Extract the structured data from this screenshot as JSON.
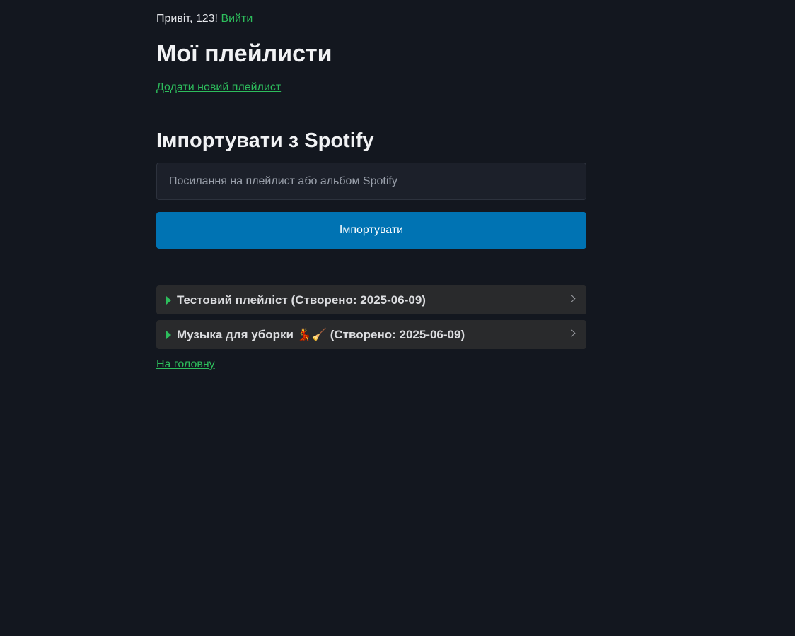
{
  "header": {
    "greeting": "Привіт, 123!",
    "logout_label": "Вийти"
  },
  "page_title": "Мої плейлисти",
  "add_playlist_label": "Додати новий плейлист",
  "spotify_import": {
    "title": "Імпортувати з Spotify",
    "input_placeholder": "Посилання на плейлист або альбом Spotify",
    "input_value": "",
    "button_label": "Імпортувати"
  },
  "playlists": [
    {
      "title": "Тестовий плейліст (Створено: 2025-06-09)"
    },
    {
      "title": "Музыка для уборки 💃🧹 (Створено: 2025-06-09)"
    }
  ],
  "home_link_label": "На головну",
  "colors": {
    "background": "#13171f",
    "accent_link": "#2dbd5c",
    "primary_button": "#0073b3",
    "playlist_item_bg": "#292a2c"
  },
  "icons": {
    "expand": "caret-right-icon",
    "open": "chevron-right-icon"
  }
}
